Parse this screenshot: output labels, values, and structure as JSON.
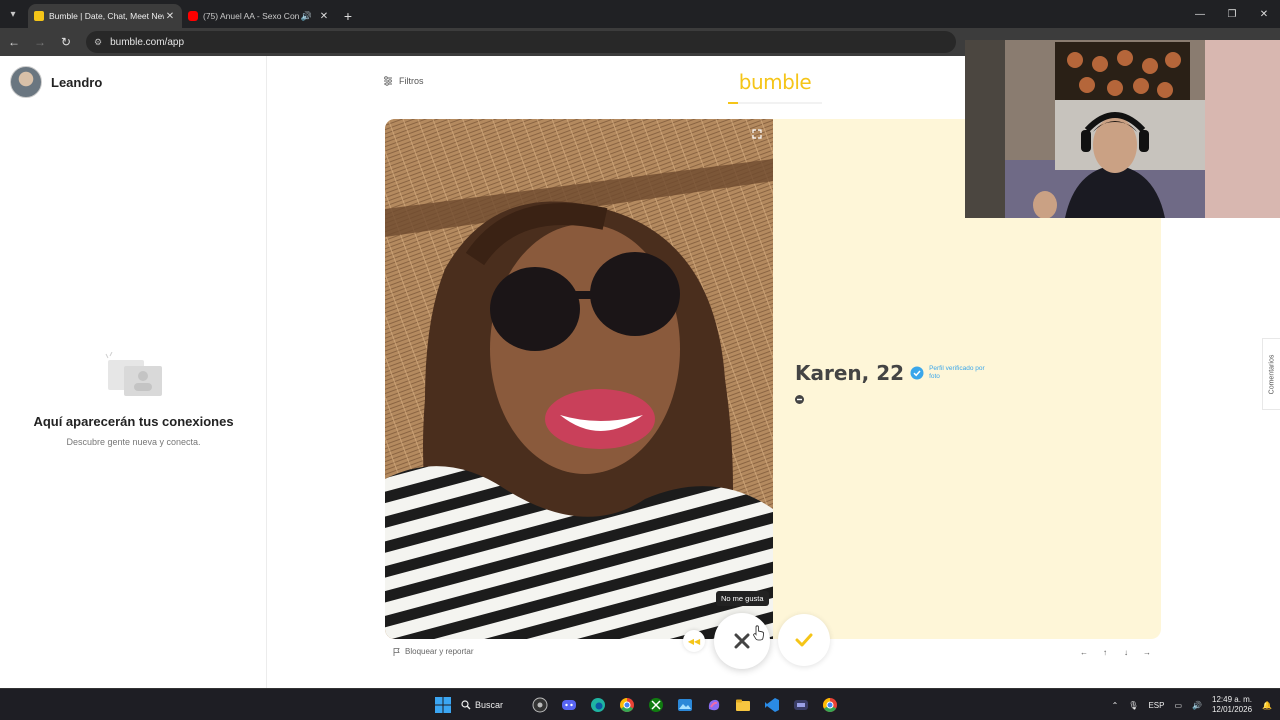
{
  "browser": {
    "tabs": [
      {
        "title": "Bumble | Date, Chat, Meet New",
        "favicon_color": "#f5c518",
        "active": true
      },
      {
        "title": "(75) Anuel AA - Sexo Con C",
        "favicon_color": "#ff0000",
        "active": false,
        "audio": true
      }
    ],
    "url": "bumble.com/app"
  },
  "sidebar": {
    "user_name": "Leandro",
    "empty_title": "Aquí aparecerán tus conexiones",
    "empty_subtitle": "Descubre gente nueva y conecta."
  },
  "main": {
    "filters_label": "Filtros",
    "logo_text": "bumble",
    "profile": {
      "name_age": "Karen, 22",
      "verified_text": "Perfil verificado por foto"
    },
    "report_label": "Bloquear y reportar",
    "tooltip": "No me gusta",
    "side_tab_label": "Comentarios"
  },
  "taskbar": {
    "search_label": "Buscar",
    "lang": "ESP",
    "time": "12:49 a. m.",
    "date": "12/01/2026"
  },
  "colors": {
    "brand": "#f5c518",
    "card_bg": "#fef6d8",
    "verified": "#3aa6ea"
  }
}
